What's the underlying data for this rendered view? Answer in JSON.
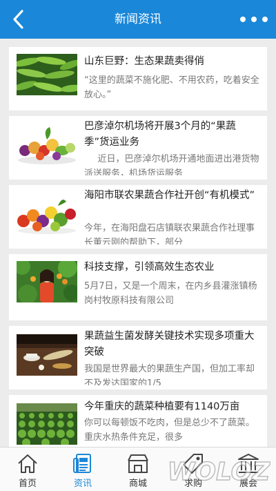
{
  "header": {
    "title": "新闻资讯",
    "back_icon": "back-icon",
    "more_icon": "more-icon"
  },
  "news": [
    {
      "title": "山东巨野：生态果蔬卖得俏",
      "summary": "“这里的蔬菜不施化肥、不用农药，吃着安全放心。”",
      "thumb": "green-beans"
    },
    {
      "title": "巴彦淖尔机场将开展3个月的“果蔬季”货运业务",
      "summary": "近日，巴彦淖尔机场开通地面进出港货物派送服务，机场货运服务",
      "thumb": "fruit-vegetable-pile"
    },
    {
      "title": "海阳市联农果蔬合作社开创“有机模式”",
      "summary": "今年，在海阳盘石店镇联农果蔬合作社理事长董云刚的帮助下，部分",
      "thumb": "colorful-produce"
    },
    {
      "title": "科技支撑，引领高效生态农业",
      "summary": "5月7日，又是一个周末，在内乡县灌涨镇杨岗村牧原科技有限公司",
      "thumb": "woman-in-orchard"
    },
    {
      "title": "果蔬益生菌发酵关键技术实现多项重大突破",
      "summary": "我国是世界最大的果蔬生产国，但加工率却不及发达国家的1/5",
      "thumb": "tea-table"
    },
    {
      "title": "今年重庆的蔬菜种植要有1140万亩",
      "summary": "你可以每顿饭不吃肉，但是总少不了蔬菜。重庆水热条件充足，很多",
      "thumb": "vegetable-field"
    }
  ],
  "tabs": [
    {
      "label": "首页",
      "icon": "home-icon",
      "active": false
    },
    {
      "label": "资讯",
      "icon": "news-icon",
      "active": true
    },
    {
      "label": "商城",
      "icon": "shop-icon",
      "active": false
    },
    {
      "label": "求购",
      "icon": "tag-icon",
      "active": false
    },
    {
      "label": "展会",
      "icon": "exhibition-icon",
      "active": false
    }
  ],
  "watermark": "WOLOZ",
  "colors": {
    "primary": "#1a87d9",
    "background": "#ececec"
  }
}
